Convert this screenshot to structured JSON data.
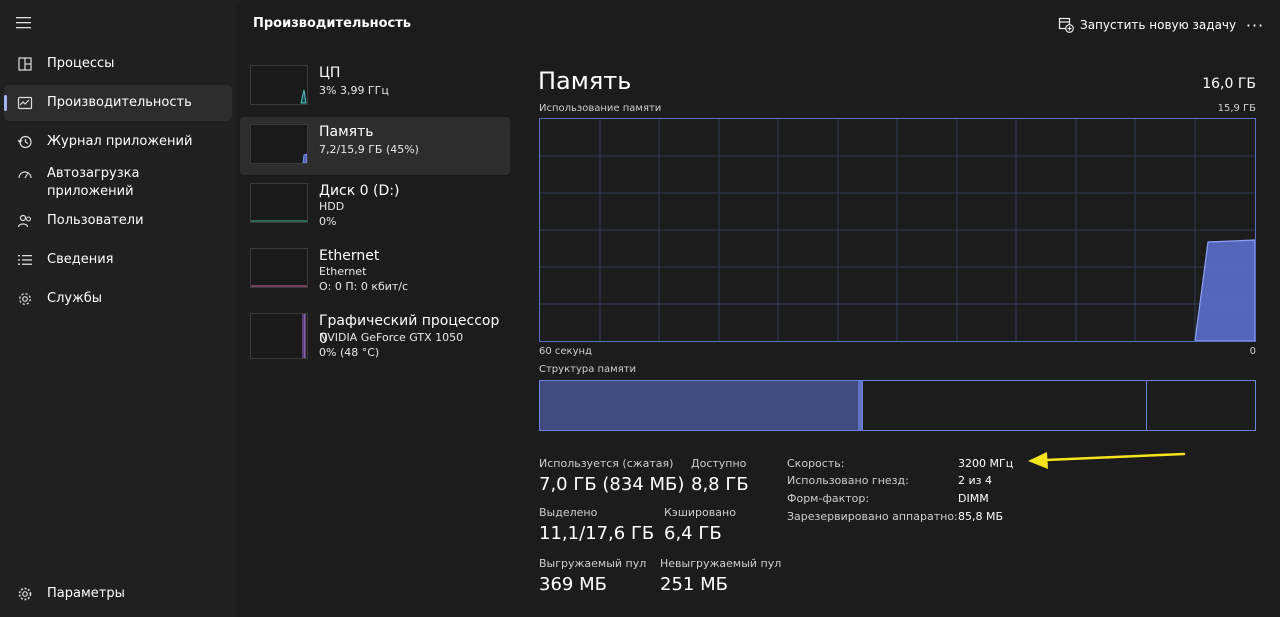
{
  "nav": {
    "items": [
      {
        "label": "Процессы",
        "icon": "processes-icon"
      },
      {
        "label": "Производительность",
        "icon": "performance-icon"
      },
      {
        "label": "Журнал приложений",
        "icon": "app-history-icon"
      },
      {
        "label": "Автозагрузка\nприложений",
        "icon": "startup-apps-icon"
      },
      {
        "label": "Пользователи",
        "icon": "users-icon"
      },
      {
        "label": "Сведения",
        "icon": "details-icon"
      },
      {
        "label": "Службы",
        "icon": "services-icon"
      }
    ],
    "settings_label": "Параметры",
    "active_index": 1
  },
  "header": {
    "title": "Производительность",
    "run_task_label": "Запустить новую задачу",
    "more_label": "···"
  },
  "devices": [
    {
      "title": "ЦП",
      "line1": "3% 3,99 ГГц",
      "line2": "",
      "color": "#4cc2c4"
    },
    {
      "title": "Память",
      "line1": "7,2/15,9 ГБ (45%)",
      "line2": "",
      "color": "#7b8ef0"
    },
    {
      "title": "Диск 0 (D:)",
      "line1": "HDD",
      "line2": "0%",
      "color": "#3fb58f"
    },
    {
      "title": "Ethernet",
      "line1": "Ethernet",
      "line2": "О: 0 П: 0 кбит/с",
      "color": "#d0609a"
    },
    {
      "title": "Графический процессор 0",
      "line1": "NVIDIA GeForce GTX 1050",
      "line2": "0%  (48 °C)",
      "color": "#b07fd8"
    }
  ],
  "detail": {
    "title": "Память",
    "total": "16,0 ГБ",
    "usage_label": "Использование памяти",
    "usage_max": "15,9 ГБ",
    "time_left": "60 секунд",
    "time_right": "0",
    "composition_label": "Структура памяти",
    "accent_color": "#7b8ef0"
  },
  "stats": {
    "in_use_label": "Используется (сжатая)",
    "in_use_value": "7,0 ГБ (834 МБ)",
    "available_label": "Доступно",
    "available_value": "8,8 ГБ",
    "committed_label": "Выделено",
    "committed_value": "11,1/17,6 ГБ",
    "cached_label": "Кэшировано",
    "cached_value": "6,4 ГБ",
    "paged_label": "Выгружаемый пул",
    "paged_value": "369 МБ",
    "nonpaged_label": "Невыгружаемый пул",
    "nonpaged_value": "251 МБ"
  },
  "specs": [
    {
      "key": "Скорость:",
      "value": "3200 МГц"
    },
    {
      "key": "Использовано гнезд:",
      "value": "2 из 4"
    },
    {
      "key": "Форм-фактор:",
      "value": "DIMM"
    },
    {
      "key": "Зарезервировано аппаратно:",
      "value": "85,8 МБ"
    }
  ],
  "annotation": {
    "type": "arrow",
    "color": "#f5e41c",
    "points_to": "Скорость value"
  }
}
